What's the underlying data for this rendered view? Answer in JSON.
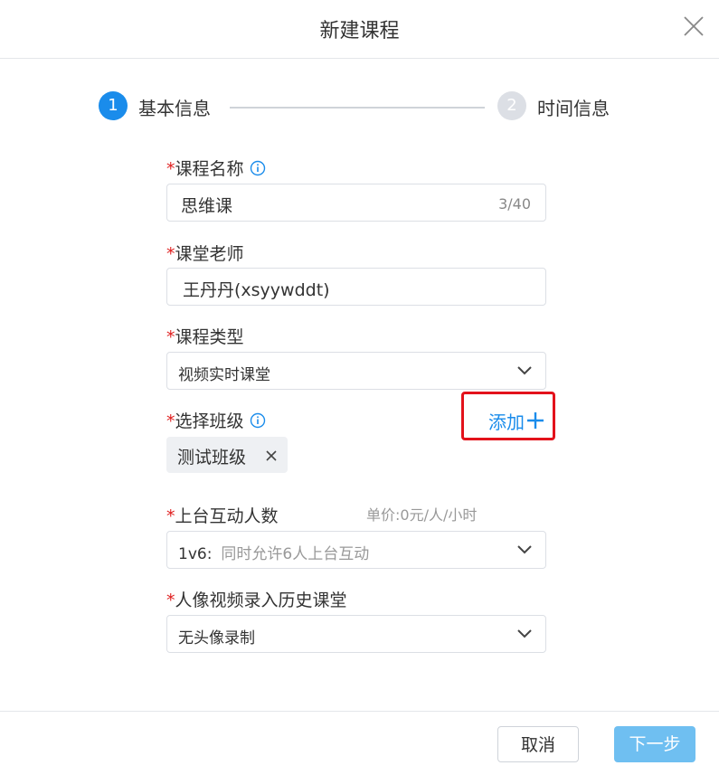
{
  "dialog": {
    "title": "新建课程"
  },
  "steps": [
    {
      "number": "1",
      "label": "基本信息"
    },
    {
      "number": "2",
      "label": "时间信息"
    }
  ],
  "form": {
    "required_mark": "*",
    "course_name": {
      "label": "课程名称",
      "value": "思维课",
      "counter": "3/40"
    },
    "teacher": {
      "label": "课堂老师",
      "value": "王丹丹(xsyywddt)"
    },
    "course_type": {
      "label": "课程类型",
      "value": "视频实时课堂"
    },
    "class_select": {
      "label": "选择班级",
      "add_label": "添加",
      "tags": [
        "测试班级"
      ]
    },
    "interaction": {
      "label": "上台互动人数",
      "price_note": "单价:0元/人/小时",
      "value": "1v6:",
      "hint": "同时允许6人上台互动"
    },
    "portrait_record": {
      "label": "人像视频录入历史课堂",
      "value": "无头像录制"
    }
  },
  "footer": {
    "cancel_label": "取消",
    "next_label": "下一步"
  },
  "colors": {
    "primary": "#1a8ceb",
    "required": "#e02020",
    "highlight_box": "#e3121b",
    "next_button": "#6fbff1"
  },
  "icons": [
    "close-icon",
    "info-icon",
    "chevron-down-icon",
    "plus-icon",
    "remove-tag-icon"
  ]
}
